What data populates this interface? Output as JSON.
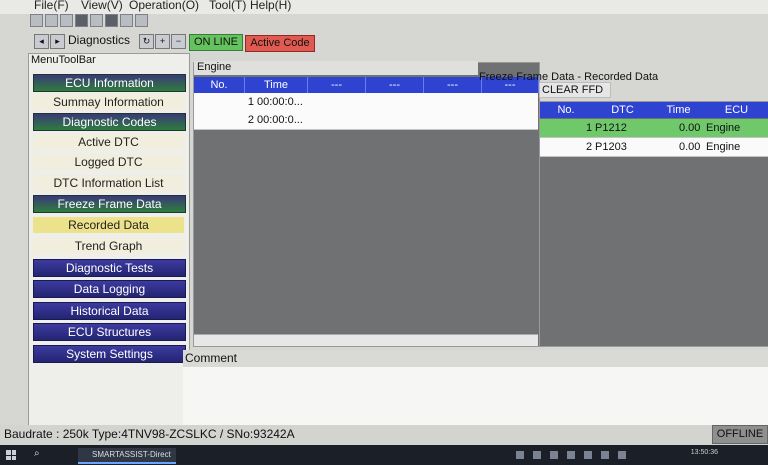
{
  "menu": {
    "file": "File(F)",
    "view": "View(V)",
    "operation": "Operation(O)",
    "tool": "Tool(T)",
    "help": "Help(H)"
  },
  "toolbar": {
    "diagnostics": "Diagnostics",
    "online": "ON LINE",
    "active_code": "Active Code",
    "online_color": "#64c35e",
    "active_code_color": "#e05a52"
  },
  "sidebar": {
    "title": "MenuToolBar",
    "items": [
      {
        "label": "ECU Information",
        "kind": "header"
      },
      {
        "label": "Summay Information",
        "kind": "item"
      },
      {
        "label": "Diagnostic Codes",
        "kind": "header"
      },
      {
        "label": "Active DTC",
        "kind": "item"
      },
      {
        "label": "Logged DTC",
        "kind": "item"
      },
      {
        "label": "DTC Information List",
        "kind": "item"
      },
      {
        "label": "Freeze Frame Data",
        "kind": "header"
      },
      {
        "label": "Recorded Data",
        "kind": "selected"
      },
      {
        "label": "Trend Graph",
        "kind": "item"
      },
      {
        "label": "Diagnostic Tests",
        "kind": "blue"
      },
      {
        "label": "Data Logging",
        "kind": "blue"
      },
      {
        "label": "Historical Data",
        "kind": "blue"
      },
      {
        "label": "ECU Structures",
        "kind": "blue"
      },
      {
        "label": "System Settings",
        "kind": "blue"
      }
    ]
  },
  "engine_panel": {
    "title": "Engine",
    "headers": [
      "No.",
      "Time",
      "---",
      "---",
      "---",
      "---"
    ],
    "rows": [
      {
        "no": "1",
        "time": "00:00:0..."
      },
      {
        "no": "2",
        "time": "00:00:0..."
      }
    ]
  },
  "ffd_panel": {
    "title": "Freeze Frame Data - Recorded Data",
    "clear_label": "CLEAR FFD",
    "headers": [
      "No.",
      "DTC",
      "Time",
      "ECU"
    ],
    "rows": [
      {
        "no": "1",
        "dtc": "P1212",
        "time": "0.00",
        "ecu": "Engine"
      },
      {
        "no": "2",
        "dtc": "P1203",
        "time": "0.00",
        "ecu": "Engine"
      }
    ],
    "selected_color": "#6fc96a"
  },
  "comment": {
    "label": "Comment"
  },
  "status": {
    "text": "Baudrate : 250k Type:4TNV98-ZCSLKC / SNo:93242A",
    "offline": "OFFLINE"
  },
  "taskbar": {
    "app": "SMARTASSIST-Direct",
    "clock": "13:50:36"
  }
}
